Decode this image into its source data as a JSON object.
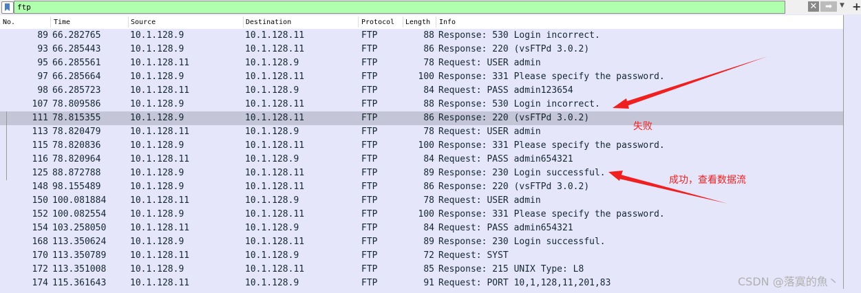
{
  "filter": {
    "value": "ftp",
    "clear_icon": "close-icon",
    "apply_icon": "arrow-right-icon",
    "dropdown_icon": "chevron-down-icon",
    "add_icon": "plus-icon"
  },
  "columns": [
    "No.",
    "Time",
    "Source",
    "Destination",
    "Protocol",
    "Length",
    "Info"
  ],
  "packets": [
    [
      "89",
      "66.282765",
      "10.1.128.9",
      "10.1.128.11",
      "FTP",
      "88",
      "Response: 530 Login incorrect."
    ],
    [
      "93",
      "66.285443",
      "10.1.128.9",
      "10.1.128.11",
      "FTP",
      "86",
      "Response: 220 (vsFTPd 3.0.2)"
    ],
    [
      "95",
      "66.285561",
      "10.1.128.11",
      "10.1.128.9",
      "FTP",
      "78",
      "Request: USER admin"
    ],
    [
      "97",
      "66.285664",
      "10.1.128.9",
      "10.1.128.11",
      "FTP",
      "100",
      "Response: 331 Please specify the password."
    ],
    [
      "98",
      "66.285723",
      "10.1.128.11",
      "10.1.128.9",
      "FTP",
      "84",
      "Request: PASS admin123654"
    ],
    [
      "107",
      "78.809586",
      "10.1.128.9",
      "10.1.128.11",
      "FTP",
      "88",
      "Response: 530 Login incorrect."
    ],
    [
      "111",
      "78.815355",
      "10.1.128.9",
      "10.1.128.11",
      "FTP",
      "86",
      "Response: 220 (vsFTPd 3.0.2)"
    ],
    [
      "113",
      "78.820479",
      "10.1.128.11",
      "10.1.128.9",
      "FTP",
      "78",
      "Request: USER admin"
    ],
    [
      "115",
      "78.820836",
      "10.1.128.9",
      "10.1.128.11",
      "FTP",
      "100",
      "Response: 331 Please specify the password."
    ],
    [
      "116",
      "78.820964",
      "10.1.128.11",
      "10.1.128.9",
      "FTP",
      "84",
      "Request: PASS admin654321"
    ],
    [
      "125",
      "88.872788",
      "10.1.128.9",
      "10.1.128.11",
      "FTP",
      "89",
      "Response: 230 Login successful."
    ],
    [
      "148",
      "98.155489",
      "10.1.128.9",
      "10.1.128.11",
      "FTP",
      "86",
      "Response: 220 (vsFTPd 3.0.2)"
    ],
    [
      "150",
      "100.081884",
      "10.1.128.11",
      "10.1.128.9",
      "FTP",
      "78",
      "Request: USER admin"
    ],
    [
      "152",
      "100.082554",
      "10.1.128.9",
      "10.1.128.11",
      "FTP",
      "100",
      "Response: 331 Please specify the password."
    ],
    [
      "154",
      "103.258050",
      "10.1.128.11",
      "10.1.128.9",
      "FTP",
      "84",
      "Request: PASS admin654321"
    ],
    [
      "168",
      "113.350624",
      "10.1.128.9",
      "10.1.128.11",
      "FTP",
      "89",
      "Response: 230 Login successful."
    ],
    [
      "170",
      "113.350789",
      "10.1.128.11",
      "10.1.128.9",
      "FTP",
      "72",
      "Request: SYST"
    ],
    [
      "172",
      "113.351008",
      "10.1.128.9",
      "10.1.128.11",
      "FTP",
      "85",
      "Response: 215 UNIX Type: L8"
    ],
    [
      "174",
      "115.361643",
      "10.1.128.11",
      "10.1.128.9",
      "FTP",
      "91",
      "Request: PORT 10,1,128,11,201,83"
    ]
  ],
  "selected_row": "111",
  "annotations": {
    "fail": "失败",
    "success": "成功，查看数据流",
    "color": "#f02020"
  },
  "watermark": "CSDN @落寞的魚丶"
}
